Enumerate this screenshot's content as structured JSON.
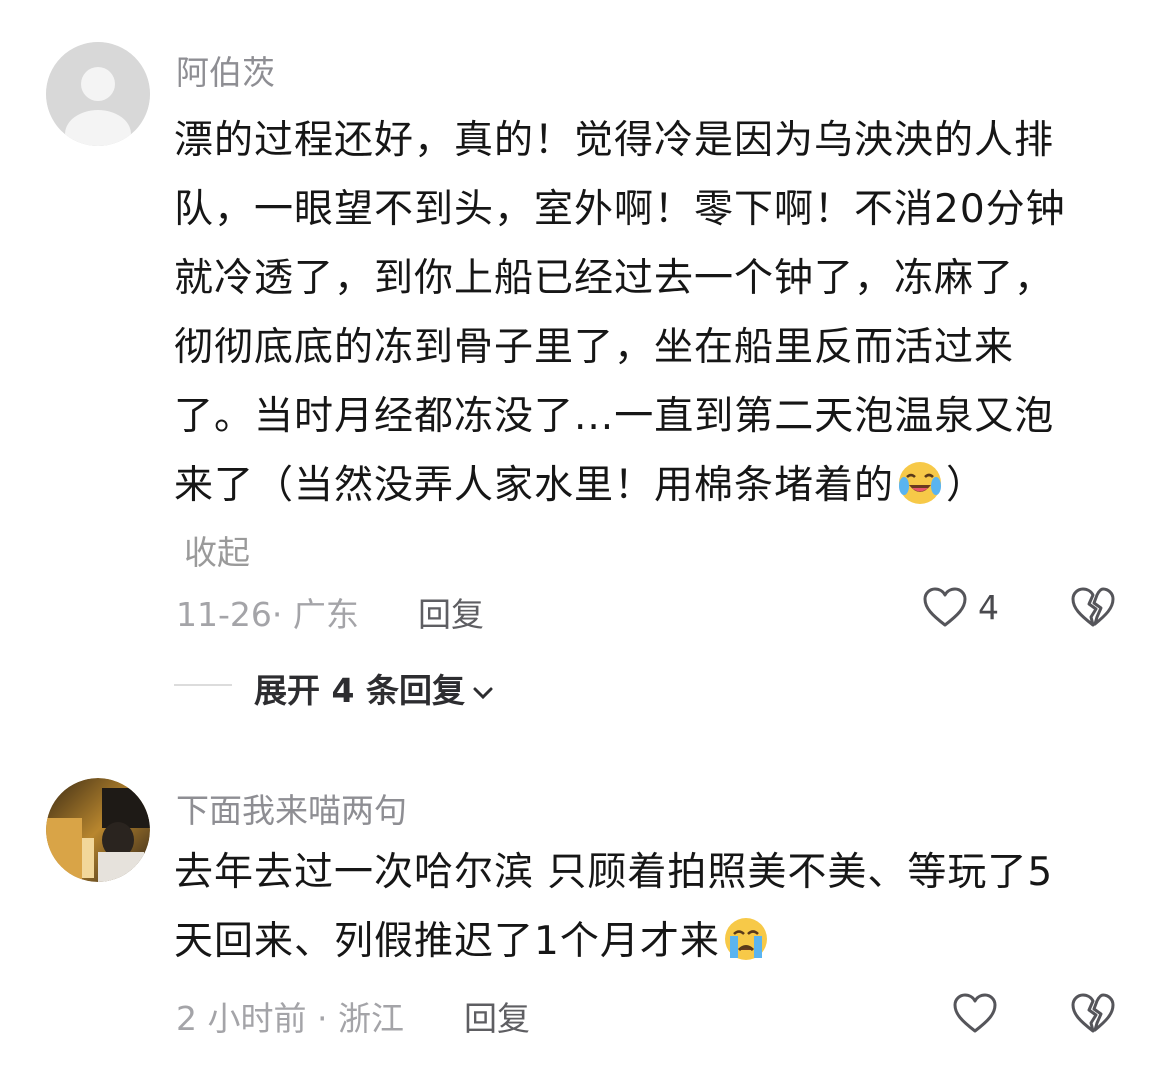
{
  "comments": [
    {
      "username": "阿伯茨",
      "lines": [
        "漂的过程还好，真的！觉得冷是因为乌泱泱的人排",
        "队，一眼望不到头，室外啊！零下啊！不消20分钟",
        "就冷透了，到你上船已经过去一个钟了，冻麻了，",
        "彻彻底底的冻到骨子里了，坐在船里反而活过来",
        "了。当时月经都冻没了...一直到第二天泡温泉又泡"
      ],
      "last_line_before_emoji": "来了（当然没弄人家水里！用棉条堵着的",
      "last_line_after_emoji": "）",
      "emoji": "cry-laugh-emoji",
      "collapse_label": "收起",
      "meta": "11-26· 广东",
      "reply_label": "回复",
      "like_count": "4",
      "expand_label": "展开 4 条回复"
    },
    {
      "username": "下面我来喵两句",
      "lines": [
        "去年去过一次哈尔滨 只顾着拍照美不美、等玩了5"
      ],
      "last_line_before_emoji": "天回来、列假推迟了1个月才来",
      "last_line_after_emoji": "",
      "emoji": "crying-emoji",
      "meta": "2 小时前 · 浙江",
      "reply_label": "回复"
    }
  ],
  "colors": {
    "username": "#8e8e93",
    "meta": "#a4a4a8",
    "text": "#161616",
    "default_avatar_bg": "#d9d9d9"
  }
}
